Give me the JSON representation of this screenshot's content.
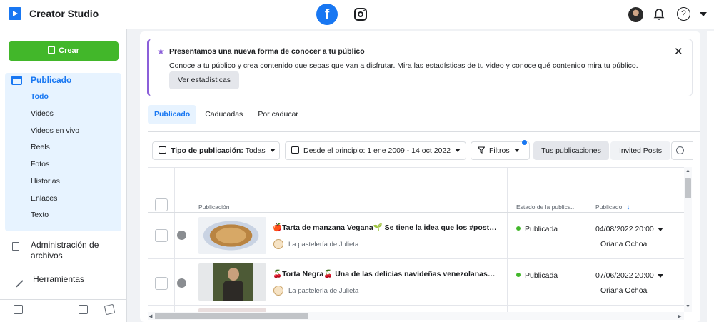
{
  "header": {
    "app_title": "Creator Studio",
    "facebook_glyph": "f",
    "help_glyph": "?"
  },
  "sidebar": {
    "create_label": "Crear",
    "section_title": "Publicado",
    "sub_items": [
      "Todo",
      "Videos",
      "Videos en vivo",
      "Reels",
      "Fotos",
      "Historias",
      "Enlaces",
      "Texto"
    ],
    "active_sub_item": "Todo",
    "files_label": "Administración de archivos",
    "tools_label": "Herramientas"
  },
  "banner": {
    "title": "Presentamos una nueva forma de conocer a tu público",
    "text": "Conoce a tu público y crea contenido que sepas que van a disfrutar. Mira las estadísticas de tu video y conoce qué contenido mira tu público.",
    "button_label": "Ver estadísticas",
    "close_glyph": "✕",
    "star_glyph": "★"
  },
  "tabs": [
    "Publicado",
    "Caducadas",
    "Por caducar"
  ],
  "filters": {
    "type_label": "Tipo de publicación:",
    "type_value": "Todas",
    "date_range": "Desde el principio: 1 ene 2009 - 14 oct 2022",
    "filters_label": "Filtros",
    "your_posts_label": "Tus publicaciones",
    "invited_posts_label": "Invited Posts"
  },
  "table": {
    "columns": {
      "post": "Publicación",
      "status": "Estado de la publica...",
      "published": "Publicado"
    },
    "sort_arrow": "↓",
    "rows": [
      {
        "title": "🍎Tarta de manzana Vegana🌱 Se tiene la idea que los #postresv...",
        "page": "La pastelería de Julieta",
        "status": "Publicada",
        "date": "04/08/2022 20:00",
        "author": "Oriana Ochoa"
      },
      {
        "title": "🍒Torta Negra🍒 Una de las delicias navideñas venezolanas. Ant...",
        "page": "La pastelería de Julieta",
        "status": "Publicada",
        "date": "07/06/2022 20:00",
        "author": "Oriana Ochoa"
      }
    ]
  },
  "colors": {
    "accent": "#1877f2",
    "create_green": "#42b72a",
    "banner_purple": "#8b5fd9",
    "status_green": "#42b72a"
  }
}
